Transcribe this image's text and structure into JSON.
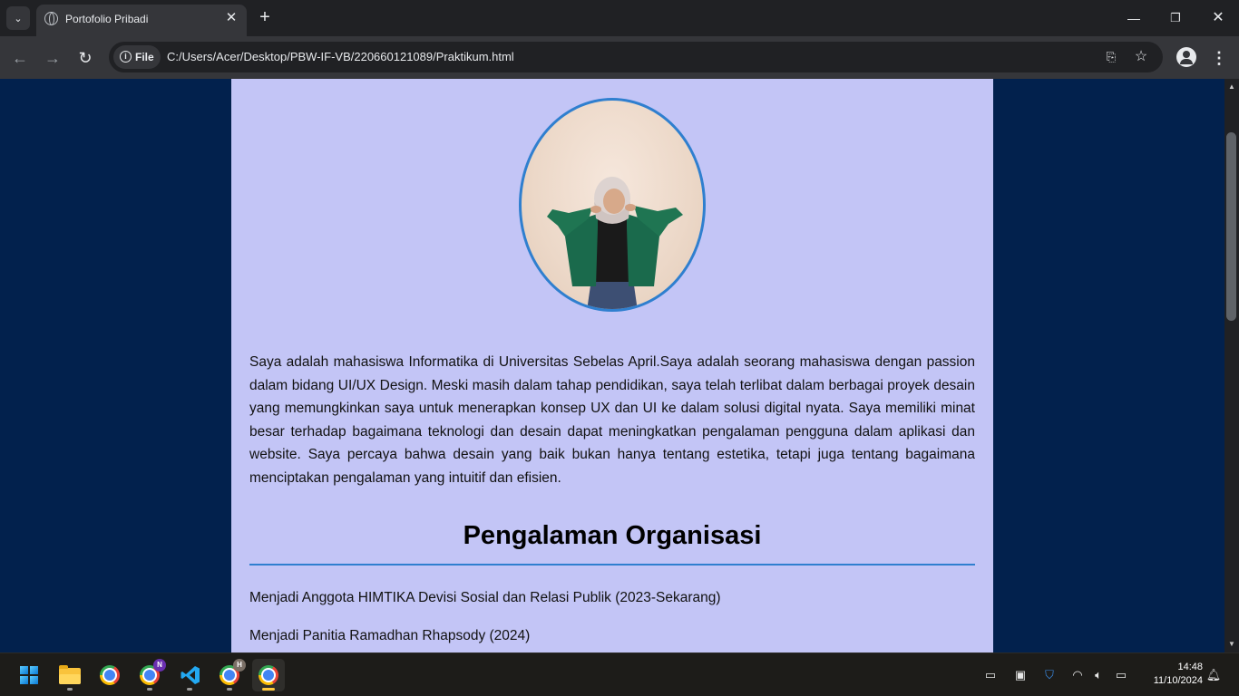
{
  "browser": {
    "tab_title": "Portofolio Pribadi",
    "chip_label": "File",
    "url": "C:/Users/Acer/Desktop/PBW-IF-VB/220660121089/Praktikum.html"
  },
  "page": {
    "photo_alt": "",
    "bio": "Saya adalah mahasiswa Informatika di Universitas Sebelas April.Saya adalah seorang mahasiswa dengan passion dalam bidang UI/UX Design. Meski masih dalam tahap pendidikan, saya telah terlibat dalam berbagai proyek desain yang memungkinkan saya untuk menerapkan konsep UX dan UI ke dalam solusi digital nyata. Saya memiliki minat besar terhadap bagaimana teknologi dan desain dapat meningkatkan pengalaman pengguna dalam aplikasi dan website. Saya percaya bahwa desain yang baik bukan hanya tentang estetika, tetapi juga tentang bagaimana menciptakan pengalaman yang intuitif dan efisien.",
    "section_title": "Pengalaman Organisasi",
    "org_items": [
      "Menjadi Anggota HIMTIKA Devisi Sosial dan Relasi Publik (2023-Sekarang)",
      "Menjadi Panitia Ramadhan Rhapsody (2024)"
    ]
  },
  "taskbar": {
    "badges": {
      "chrome_n": "N",
      "chrome_h": "H"
    },
    "time": "14:48",
    "date": "11/10/2024"
  },
  "colors": {
    "page_bg": "#02214d",
    "card_bg": "#c3c5f6",
    "accent": "#2f7fcf"
  }
}
